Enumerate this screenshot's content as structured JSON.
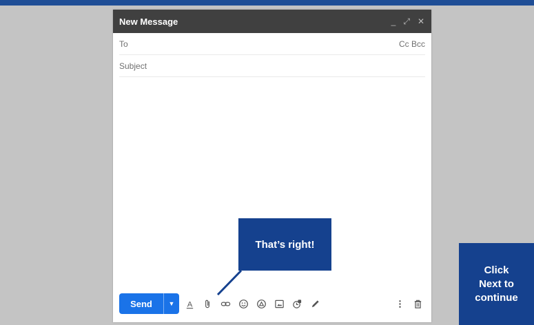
{
  "compose": {
    "title": "New Message",
    "to_placeholder": "To",
    "cc_bcc": "Cc Bcc",
    "subject_placeholder": "Subject",
    "send_label": "Send"
  },
  "toolbar_icons": [
    "format-text-icon",
    "attach-icon",
    "link-icon",
    "emoji-icon",
    "drive-icon",
    "photo-icon",
    "confidential-icon",
    "signature-icon"
  ],
  "callout": {
    "text": "That’s right!"
  },
  "next_prompt": {
    "line1": "Click",
    "line2": "Next to",
    "line3": "continue"
  },
  "colors": {
    "top_bar": "#1f4e96",
    "callout_bg": "#15418e",
    "send_bg": "#1a73e8",
    "header_bg": "#404040",
    "background": "#c4c4c4"
  }
}
